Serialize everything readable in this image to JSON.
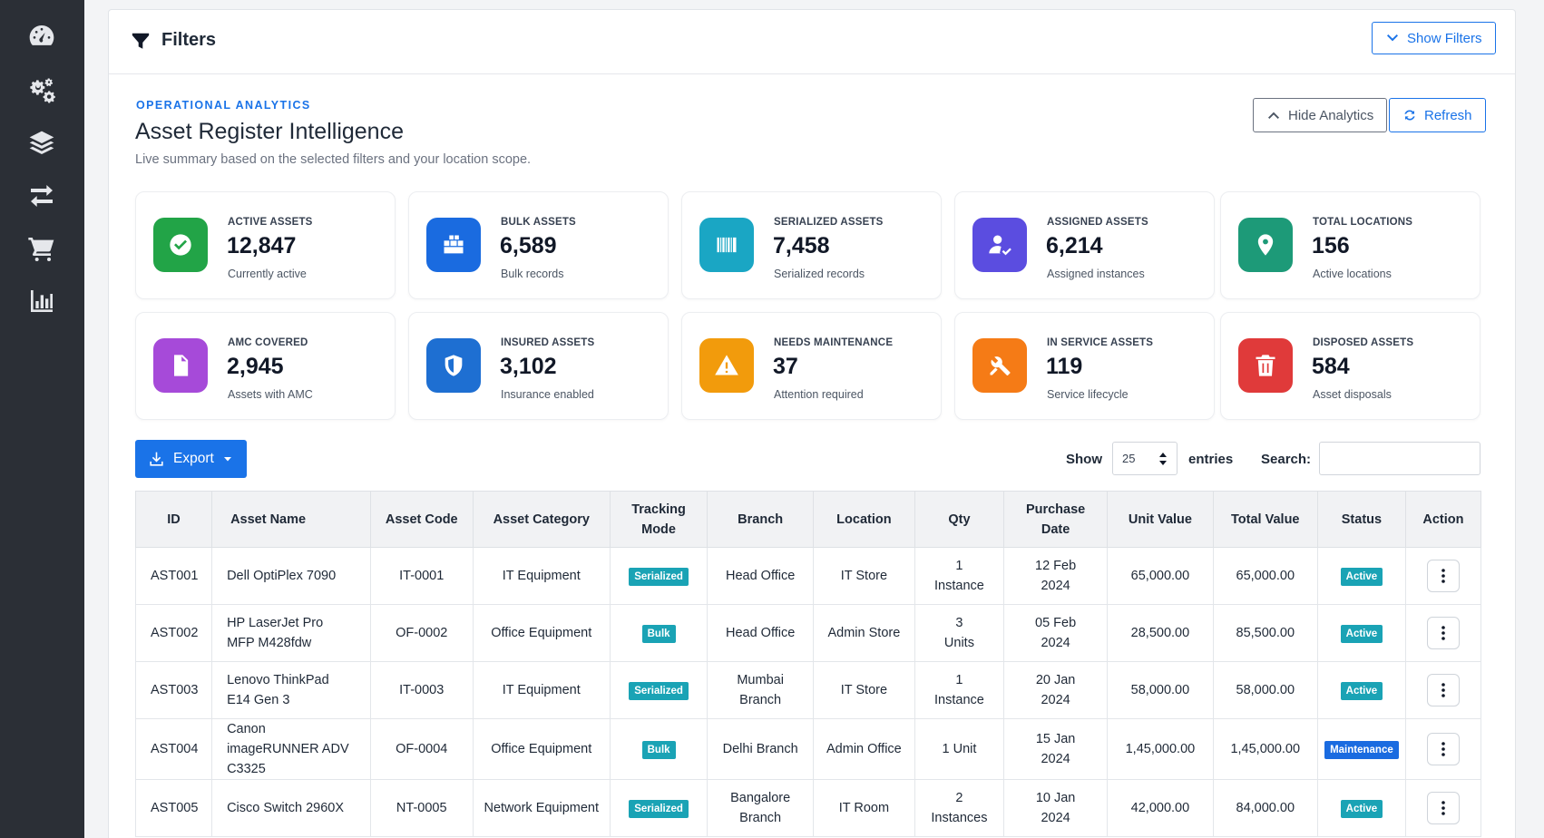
{
  "sidebar": {
    "icons": [
      "dashboard-icon",
      "settings-gears-icon",
      "layers-icon",
      "transfer-icon",
      "cart-icon",
      "chart-icon"
    ]
  },
  "filters": {
    "title": "Filters",
    "show_filters_label": "Show Filters"
  },
  "analytics": {
    "eyebrow": "OPERATIONAL ANALYTICS",
    "title": "Asset Register Intelligence",
    "subtitle": "Live summary based on the selected filters and your location scope.",
    "hide_label": "Hide Analytics",
    "refresh_label": "Refresh"
  },
  "stats": [
    {
      "label": "ACTIVE ASSETS",
      "value": "12,847",
      "caption": "Currently active",
      "color": "#22a447",
      "icon": "check-circle-icon"
    },
    {
      "label": "BULK ASSETS",
      "value": "6,589",
      "caption": "Bulk records",
      "color": "#1a6be0",
      "icon": "boxes-icon"
    },
    {
      "label": "SERIALIZED ASSETS",
      "value": "7,458",
      "caption": "Serialized records",
      "color": "#1aa6c4",
      "icon": "barcode-icon"
    },
    {
      "label": "ASSIGNED ASSETS",
      "value": "6,214",
      "caption": "Assigned instances",
      "color": "#5b4de0",
      "icon": "user-check-icon"
    },
    {
      "label": "TOTAL LOCATIONS",
      "value": "156",
      "caption": "Active locations",
      "color": "#1d9a78",
      "icon": "map-pin-icon"
    },
    {
      "label": "AMC COVERED",
      "value": "2,945",
      "caption": "Assets with AMC",
      "color": "#a64ad9",
      "icon": "document-icon"
    },
    {
      "label": "INSURED ASSETS",
      "value": "3,102",
      "caption": "Insurance enabled",
      "color": "#1e6fd2",
      "icon": "shield-icon"
    },
    {
      "label": "NEEDS MAINTENANCE",
      "value": "37",
      "caption": "Attention required",
      "color": "#f29b0c",
      "icon": "warning-icon"
    },
    {
      "label": "IN SERVICE ASSETS",
      "value": "119",
      "caption": "Service lifecycle",
      "color": "#f57b16",
      "icon": "tools-icon"
    },
    {
      "label": "DISPOSED ASSETS",
      "value": "584",
      "caption": "Asset disposals",
      "color": "#e03a3a",
      "icon": "trash-icon"
    }
  ],
  "controls": {
    "export_label": "Export",
    "show_label": "Show",
    "page_size": "25",
    "entries_label": "entries",
    "search_label": "Search:",
    "search_value": ""
  },
  "table": {
    "headers": [
      "ID",
      "Asset Name",
      "Asset Code",
      "Asset Category",
      "Tracking Mode",
      "Branch",
      "Location",
      "Qty",
      "Purchase Date",
      "Unit Value",
      "Total Value",
      "Status",
      "Action"
    ],
    "rows": [
      {
        "id": "AST001",
        "name": "Dell OptiPlex 7090",
        "code": "IT-0001",
        "category": "IT Equipment",
        "mode": "Serialized",
        "branch": "Head Office",
        "location": "IT Store",
        "qty": "1 Instance",
        "date": "12 Feb 2024",
        "unit": "65,000.00",
        "total": "65,000.00",
        "status": "Active"
      },
      {
        "id": "AST002",
        "name": "HP LaserJet Pro MFP M428fdw",
        "code": "OF-0002",
        "category": "Office Equipment",
        "mode": "Bulk",
        "branch": "Head Office",
        "location": "Admin Store",
        "qty": "3 Units",
        "date": "05 Feb 2024",
        "unit": "28,500.00",
        "total": "85,500.00",
        "status": "Active"
      },
      {
        "id": "AST003",
        "name": "Lenovo ThinkPad E14 Gen 3",
        "code": "IT-0003",
        "category": "IT Equipment",
        "mode": "Serialized",
        "branch": "Mumbai Branch",
        "location": "IT Store",
        "qty": "1 Instance",
        "date": "20 Jan 2024",
        "unit": "58,000.00",
        "total": "58,000.00",
        "status": "Active"
      },
      {
        "id": "AST004",
        "name": "Canon imageRUNNER ADV C3325",
        "code": "OF-0004",
        "category": "Office Equipment",
        "mode": "Bulk",
        "branch": "Delhi Branch",
        "location": "Admin Office",
        "qty": "1 Unit",
        "date": "15 Jan 2024",
        "unit": "1,45,000.00",
        "total": "1,45,000.00",
        "status": "Maintenance"
      },
      {
        "id": "AST005",
        "name": "Cisco Switch 2960X",
        "code": "NT-0005",
        "category": "Network Equipment",
        "mode": "Serialized",
        "branch": "Bangalore Branch",
        "location": "IT Room",
        "qty": "2 Instances",
        "date": "10 Jan 2024",
        "unit": "42,000.00",
        "total": "84,000.00",
        "status": "Active"
      }
    ]
  },
  "colors": {
    "primary": "#1a73e8",
    "badge_serialized": "#1aa3b5",
    "badge_bulk": "#1aa3b5",
    "badge_active": "#1aa3b5",
    "badge_maintenance": "#1a6be0"
  }
}
